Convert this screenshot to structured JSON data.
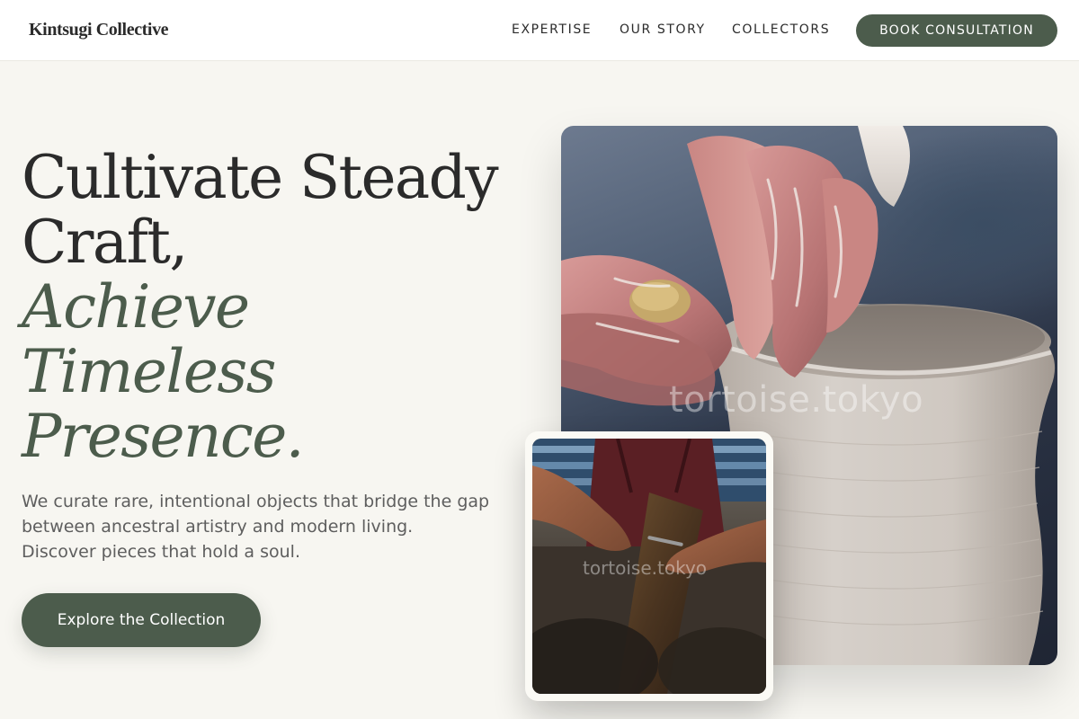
{
  "header": {
    "brand": "Kintsugi Collective",
    "nav": {
      "expertise": "EXPERTISE",
      "story": "OUR STORY",
      "collectors": "COLLECTORS"
    },
    "cta_label": "BOOK CONSULTATION"
  },
  "hero": {
    "headline": {
      "line1": "Cultivate Steady",
      "line2": "Craft,",
      "line3": "Achieve",
      "line4": "Timeless",
      "line5": "Presence."
    },
    "subcopy": {
      "line1": "We curate rare, intentional objects that bridge the gap",
      "line2": "between ancestral artistry and modern living.",
      "line3": "Discover pieces that hold a soul."
    },
    "cta_label": "Explore the Collection"
  },
  "images": {
    "main_watermark": "tortoise.tokyo",
    "small_watermark": "tortoise.tokyo"
  },
  "colors": {
    "background": "#f7f6f1",
    "accent_green": "#4c5c4c",
    "text_dark": "#2b2b2b",
    "text_muted": "#5e5e5e"
  }
}
